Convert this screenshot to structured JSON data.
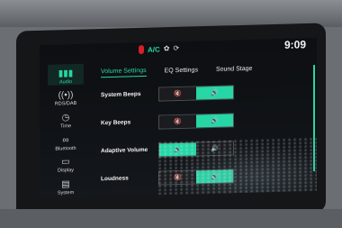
{
  "status": {
    "ac_label": "A/C",
    "clock": "9:09"
  },
  "sidebar": {
    "items": [
      {
        "label": "Audio",
        "icon": "bars-icon",
        "glyph": "▮▮▮",
        "active": true
      },
      {
        "label": "RDS/DAB",
        "icon": "radio-icon",
        "glyph": "((•))",
        "active": false
      },
      {
        "label": "Time",
        "icon": "clock-icon",
        "glyph": "◷",
        "active": false
      },
      {
        "label": "Bluetooth",
        "icon": "bluetooth-icon",
        "glyph": "∞",
        "active": false
      },
      {
        "label": "Display",
        "icon": "display-icon",
        "glyph": "▭",
        "active": false
      },
      {
        "label": "System",
        "icon": "system-icon",
        "glyph": "▤",
        "active": false
      }
    ]
  },
  "tabs": [
    {
      "label": "Volume Settings",
      "active": true
    },
    {
      "label": "EQ Settings",
      "active": false
    },
    {
      "label": "Sound Stage",
      "active": false
    }
  ],
  "rows": [
    {
      "label": "System Beeps",
      "left_icon": "mute-icon",
      "right_icon": "speaker-icon",
      "left_glyph": "🔇",
      "right_glyph": "🔊",
      "selected": "right"
    },
    {
      "label": "Key Beeps",
      "left_icon": "mute-icon",
      "right_icon": "speaker-icon",
      "left_glyph": "🔇",
      "right_glyph": "🔊",
      "selected": "right"
    },
    {
      "label": "Adaptive Volume",
      "left_icon": "speaker-low-icon",
      "right_icon": "speaker-high-icon",
      "left_glyph": "🔉",
      "right_glyph": "🔊",
      "selected": "left"
    },
    {
      "label": "Loudness",
      "left_icon": "mute-icon",
      "right_icon": "speaker-icon",
      "left_glyph": "🔇",
      "right_glyph": "🔊",
      "selected": "right"
    }
  ],
  "colors": {
    "accent": "#27d6a5",
    "alert": "#d3202a"
  }
}
